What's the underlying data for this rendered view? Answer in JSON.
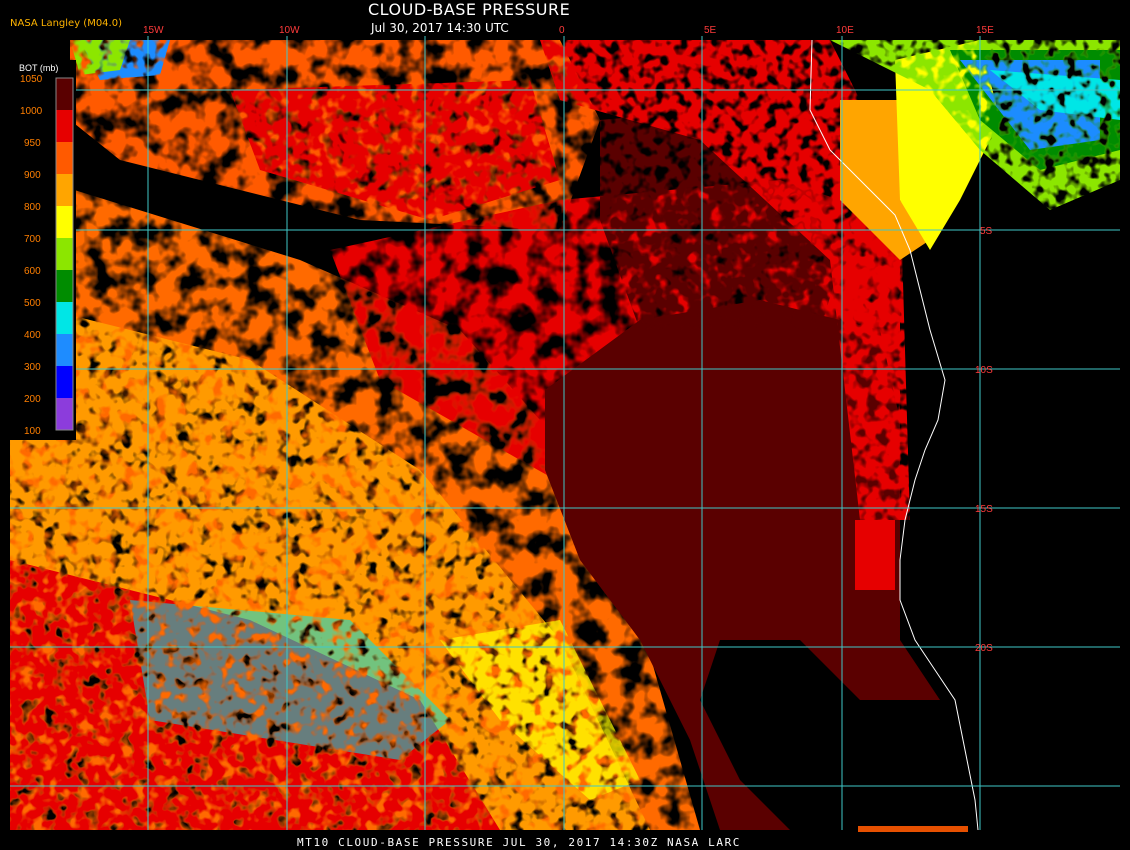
{
  "header": {
    "title": "CLOUD-BASE PRESSURE",
    "subtitle": "Jul 30, 2017 14:30 UTC",
    "agency": "NASA Langley (M04.0)"
  },
  "footer": {
    "text": "MT10  CLOUD-BASE PRESSURE   JUL 30, 2017 14:30Z   NASA LARC"
  },
  "colorbar": {
    "title": "BOT (mb)",
    "levels": [
      "1050",
      "1000",
      "950",
      "900",
      "800",
      "700",
      "600",
      "500",
      "400",
      "300",
      "200",
      "100"
    ],
    "colors": [
      "#5a0000",
      "#e60000",
      "#ff5a00",
      "#ffa500",
      "#ffff00",
      "#8ce600",
      "#008c00",
      "#00e6e6",
      "#1e8cff",
      "#0000ff",
      "#8c3cdc"
    ]
  },
  "grid": {
    "lon_labels": [
      "15W",
      "10W",
      "0",
      "5E",
      "10E",
      "15E"
    ],
    "lat_labels": [
      "5S",
      "10S",
      "15S",
      "20S"
    ],
    "line_color": "#40c8c8"
  }
}
